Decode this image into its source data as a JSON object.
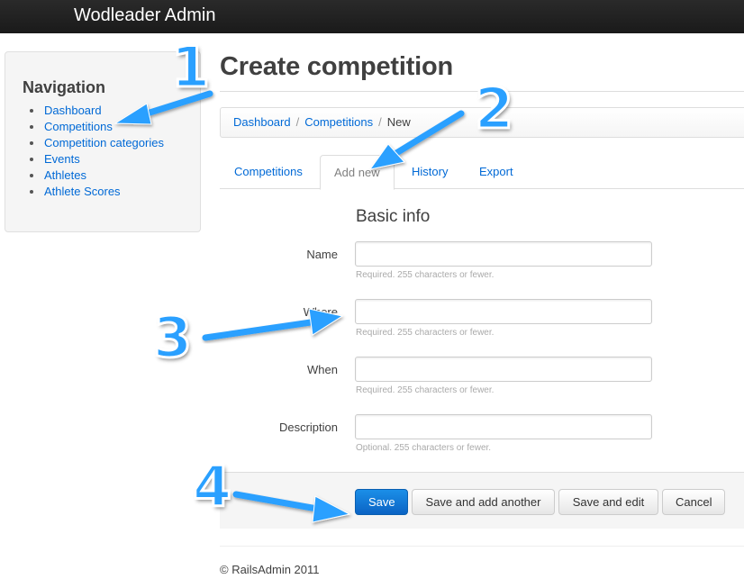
{
  "app": {
    "title": "Wodleader Admin"
  },
  "sidebar": {
    "heading": "Navigation",
    "items": [
      {
        "label": "Dashboard"
      },
      {
        "label": "Competitions"
      },
      {
        "label": "Competition categories"
      },
      {
        "label": "Events"
      },
      {
        "label": "Athletes"
      },
      {
        "label": "Athlete Scores"
      }
    ]
  },
  "main": {
    "title": "Create competition",
    "breadcrumb": [
      {
        "label": "Dashboard"
      },
      {
        "label": "Competitions"
      },
      {
        "label": "New"
      }
    ],
    "breadcrumb_separator": "/",
    "tabs": [
      {
        "label": "Competitions",
        "active": false
      },
      {
        "label": "Add new",
        "active": true
      },
      {
        "label": "History",
        "active": false
      },
      {
        "label": "Export",
        "active": false
      }
    ],
    "section_title": "Basic info",
    "fields": [
      {
        "label": "Name",
        "value": "",
        "help": "Required. 255 characters or fewer."
      },
      {
        "label": "Where",
        "value": "",
        "help": "Required. 255 characters or fewer."
      },
      {
        "label": "When",
        "value": "",
        "help": "Required. 255 characters or fewer."
      },
      {
        "label": "Description",
        "value": "",
        "help": "Optional. 255 characters or fewer."
      }
    ],
    "buttons": {
      "save": "Save",
      "save_add_another": "Save and add another",
      "save_edit": "Save and edit",
      "cancel": "Cancel"
    }
  },
  "footer": {
    "text": "© RailsAdmin 2011"
  },
  "annotations": {
    "callouts": [
      "1",
      "2",
      "3",
      "4"
    ],
    "color": "#2aa0ff"
  },
  "colors": {
    "topbar": "#1a1a1a",
    "link": "#0069d6",
    "primary_button": "#0b63c4"
  }
}
